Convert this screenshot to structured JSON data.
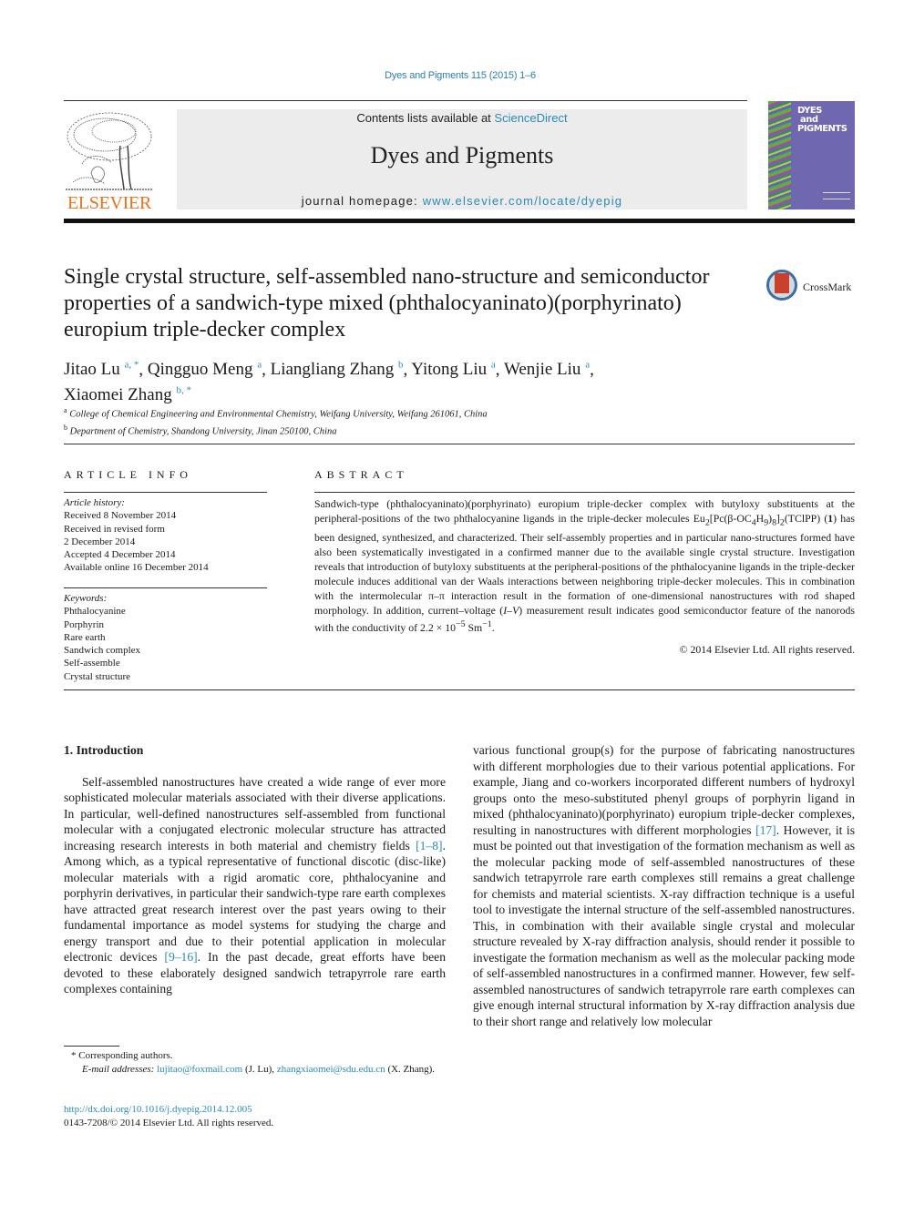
{
  "running_head": "Dyes and Pigments 115 (2015) 1–6",
  "publisher": {
    "name": "ELSEVIER",
    "logo_icon": "elsevier-tree-icon",
    "color": "#e8731f"
  },
  "masthead": {
    "contents_prefix": "Contents lists available at ",
    "contents_link": "ScienceDirect",
    "journal_title": "Dyes and Pigments",
    "homepage_prefix": "journal homepage: ",
    "homepage_link": "www.elsevier.com/locate/dyepig",
    "background": "#ececec"
  },
  "cover": {
    "title": "DYES\n and\nPIGMENTS",
    "color": "#6f68b0"
  },
  "crossmark": {
    "label": "CrossMark",
    "icon": "crossmark-icon"
  },
  "article": {
    "title": "Single crystal structure, self-assembled nano-structure and semiconductor properties of a sandwich-type mixed (phthalocyaninato)(porphyrinato) europium triple-decker complex",
    "authors": [
      {
        "name": "Jitao Lu",
        "sup": "a, *",
        "sep": ", "
      },
      {
        "name": "Qingguo Meng",
        "sup": "a",
        "sep": ", "
      },
      {
        "name": "Liangliang Zhang",
        "sup": "b",
        "sep": ", "
      },
      {
        "name": "Yitong Liu",
        "sup": "a",
        "sep": ", "
      },
      {
        "name": "Wenjie Liu",
        "sup": "a",
        "sep": ", "
      },
      {
        "name": "Xiaomei Zhang",
        "sup": "b, *",
        "sep": ""
      }
    ],
    "affiliations": [
      {
        "sup": "a",
        "text": "College of Chemical Engineering and Environmental Chemistry, Weifang University, Weifang 261061, China"
      },
      {
        "sup": "b",
        "text": "Department of Chemistry, Shandong University, Jinan 250100, China"
      }
    ]
  },
  "article_info": {
    "heading": "ARTICLE INFO",
    "history_label": "Article history:",
    "history": [
      "Received 8 November 2014",
      "Received in revised form",
      "2 December 2014",
      "Accepted 4 December 2014",
      "Available online 16 December 2014"
    ],
    "keywords_label": "Keywords:",
    "keywords": [
      "Phthalocyanine",
      "Porphyrin",
      "Rare earth",
      "Sandwich complex",
      "Self-assemble",
      "Crystal structure"
    ]
  },
  "abstract": {
    "heading": "ABSTRACT",
    "part1": "Sandwich-type (phthalocyaninato)(porphyrinato) europium triple-decker complex with butyloxy substituents at the peripheral-positions of the two phthalocyanine ligands in the triple-decker molecules Eu",
    "formula": {
      "eu_sub": "2",
      "pc": "[Pc(β-OC",
      "c_sub": "4",
      "h": "H",
      "h_sub": "9",
      "close": ")",
      "n_sub": "8",
      "bracket": "]",
      "two_sub": "2",
      "tail": "(TClPP) ("
    },
    "compound_number": "1",
    "part2": ") has been designed, synthesized, and characterized. Their self-assembly properties and in particular nano-structures formed have also been systematically investigated in a confirmed manner due to the available single crystal structure. Investigation reveals that introduction of butyloxy substituents at the peripheral-positions of the phthalocyanine ligands in the triple-decker molecule induces additional van der Waals interactions between neighboring triple-decker molecules. This in combination with the intermolecular π–π interaction result in the formation of one-dimensional nanostructures with rod shaped morphology. In addition, current–voltage (",
    "iv": "I–V",
    "part3": ") measurement result indicates good semiconductor feature of the nanorods with the conductivity of 2.2 × 10",
    "exp1": "−5",
    "unit": " Sm",
    "exp2": "−1",
    "end": ".",
    "copyright": "© 2014 Elsevier Ltd. All rights reserved."
  },
  "body": {
    "section_title": "1.  Introduction",
    "left_p1": "Self-assembled nanostructures have created a wide range of ever more sophisticated molecular materials associated with their diverse applications. In particular, well-defined nanostructures self-assembled from functional molecular with a conjugated electronic molecular structure has attracted increasing research interests in both material and chemistry fields ",
    "ref1": "[1–8]",
    "left_p2": ". Among which, as a typical representative of functional discotic (disc-like) molecular materials with a rigid aromatic core, phthalocyanine and porphyrin derivatives, in particular their sandwich-type rare earth complexes have attracted great research interest over the past years owing to their fundamental importance as model systems for studying the charge and energy transport and due to their potential application in molecular electronic devices ",
    "ref2": "[9–16]",
    "left_p3": ". In the past decade, great efforts have been devoted to these elaborately designed sandwich tetrapyrrole rare earth complexes containing",
    "right_p1": "various functional group(s) for the purpose of fabricating nanostructures with different morphologies due to their various potential applications. For example, Jiang and co-workers incorporated different numbers of hydroxyl groups onto the meso-substituted phenyl groups of porphyrin ligand in mixed (phthalocyaninato)(porphyrinato) europium triple-decker complexes, resulting in nanostructures with different morphologies ",
    "ref3": "[17]",
    "right_p2": ". However, it is must be pointed out that investigation of the formation mechanism as well as the molecular packing mode of self-assembled nanostructures of these sandwich tetrapyrrole rare earth complexes still remains a great challenge for chemists and material scientists. X-ray diffraction technique is a useful tool to investigate the internal structure of the self-assembled nanostructures. This, in combination with their available single crystal and molecular structure revealed by X-ray diffraction analysis, should render it possible to investigate the formation mechanism as well as the molecular packing mode of self-assembled nanostructures in a confirmed manner. However, few self-assembled nanostructures of sandwich tetrapyrrole rare earth complexes can give enough internal structural information by X-ray diffraction analysis due to their short range and relatively low molecular"
  },
  "footnotes": {
    "star": "*",
    "corresponding": "Corresponding authors.",
    "email_label": "E-mail addresses:",
    "email1": "lujitao@foxmail.com",
    "email1_owner": " (J. Lu), ",
    "email2": "zhangxiaomei@sdu.edu.cn",
    "email2_owner": " (X. Zhang).",
    "doi": "http://dx.doi.org/10.1016/j.dyepig.2014.12.005",
    "issn": "0143-7208/© 2014 Elsevier Ltd. All rights reserved."
  },
  "colors": {
    "link": "#2a8ab8",
    "text": "#1a1a1a"
  }
}
